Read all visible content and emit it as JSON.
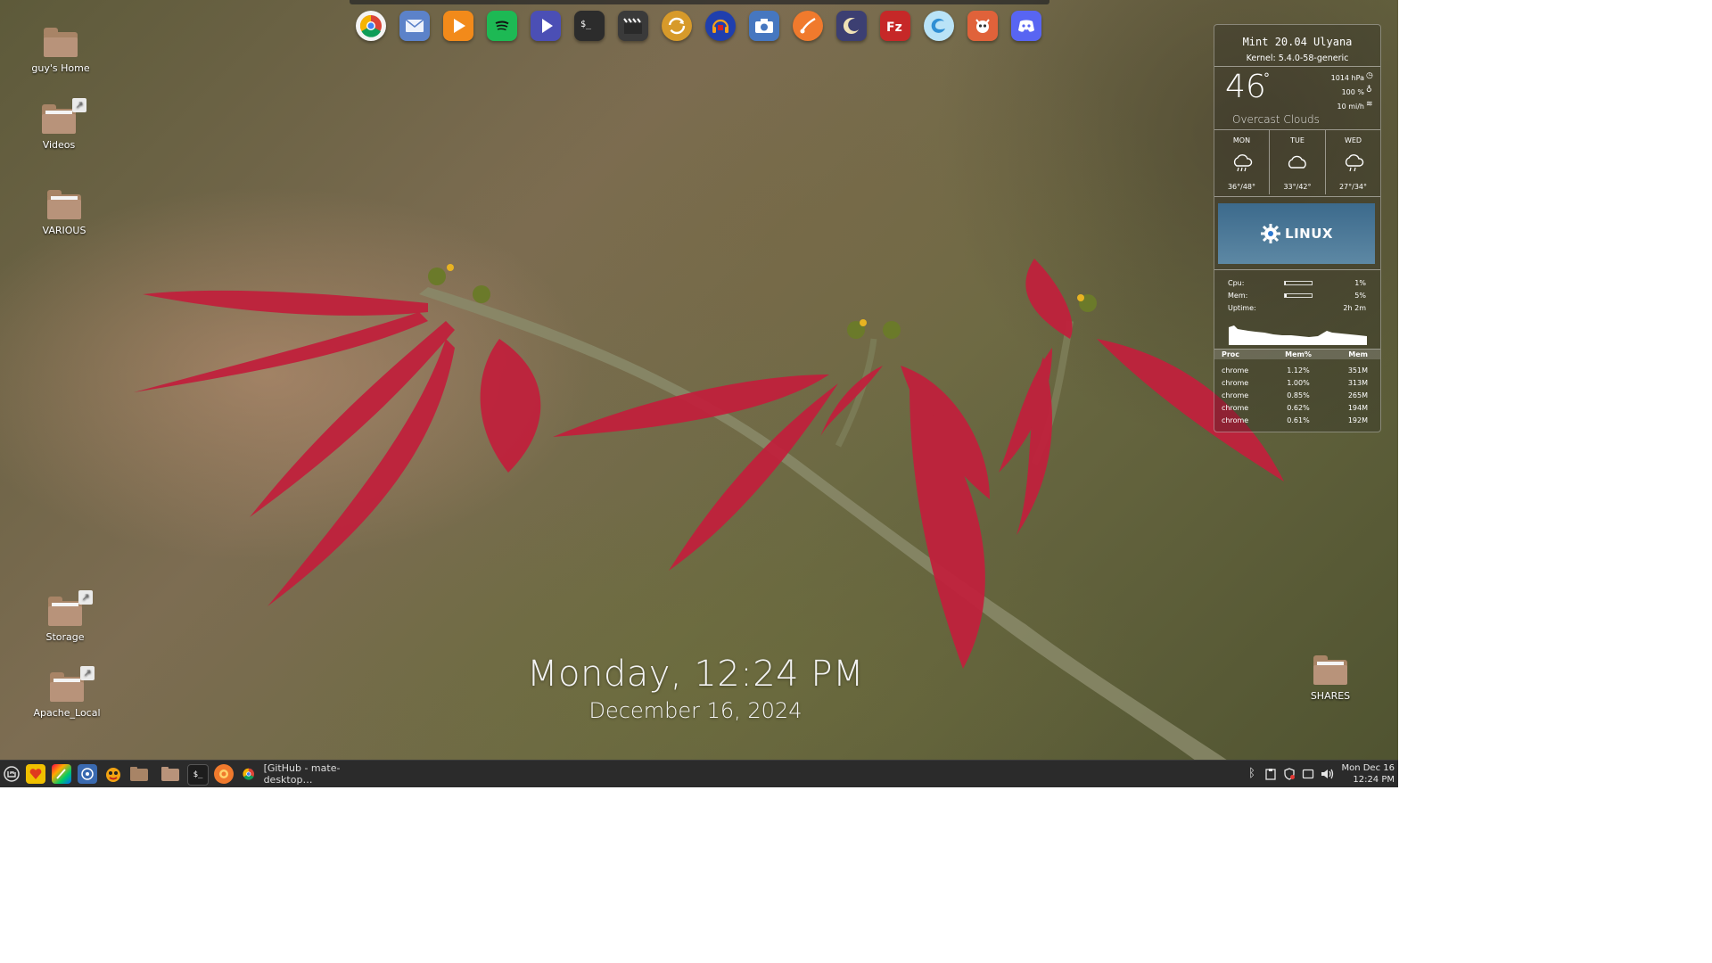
{
  "desktop": {
    "icons": [
      {
        "label": "guy's Home"
      },
      {
        "label": "Videos"
      },
      {
        "label": "VARIOUS"
      },
      {
        "label": "Storage"
      },
      {
        "label": "Apache_Local"
      },
      {
        "label": "SHARES"
      }
    ],
    "clock": {
      "time": "Monday, 12:24 PM",
      "date": "December 16, 2024"
    }
  },
  "dock": {
    "apps": [
      {
        "name": "Chrome",
        "icon": "chrome-icon",
        "color": "#ffffff"
      },
      {
        "name": "Mail",
        "icon": "mail-icon",
        "color": "#5c82c9"
      },
      {
        "name": "Media Player",
        "icon": "play-icon",
        "color": "#f28a1a"
      },
      {
        "name": "Spotify",
        "icon": "spotify-icon",
        "color": "#1db954"
      },
      {
        "name": "Video Player",
        "icon": "video-play-icon",
        "color": "#4b4fb5"
      },
      {
        "name": "Terminal",
        "icon": "terminal-icon",
        "color": "#2c2c2c"
      },
      {
        "name": "Video Editor",
        "icon": "clapper-icon",
        "color": "#3a3a3a"
      },
      {
        "name": "Sync",
        "icon": "sync-icon",
        "color": "#d79a2a"
      },
      {
        "name": "Audacity",
        "icon": "audio-headphones-icon",
        "color": "#1f3fae"
      },
      {
        "name": "Screenshot",
        "icon": "camera-icon",
        "color": "#4677c0"
      },
      {
        "name": "Media Player 2",
        "icon": "note-icon",
        "color": "#f07a2d"
      },
      {
        "name": "Night Theme",
        "icon": "moon-icon",
        "color": "#3c3f72"
      },
      {
        "name": "FileZilla",
        "icon": "filezilla-icon",
        "color": "#c62828"
      },
      {
        "name": "Edge",
        "icon": "edge-icon",
        "color": "#6bc4f0"
      },
      {
        "name": "GIMP",
        "icon": "gimp-icon",
        "color": "#e0623a"
      },
      {
        "name": "Discord",
        "icon": "discord-icon",
        "color": "#5865f2"
      }
    ]
  },
  "conky": {
    "os_name": "Mint 20.04 Ulyana",
    "kernel": "Kernel: 5.4.0-58-generic",
    "weather": {
      "temp": "46",
      "degree": "°",
      "condition": "Overcast Clouds",
      "pressure": "1014 hPa",
      "humidity": "100 %",
      "wind": "10 mi/h",
      "forecast": [
        {
          "day": "MON",
          "range": "36°/48°",
          "icon": "cloud-rain-icon"
        },
        {
          "day": "TUE",
          "range": "33°/42°",
          "icon": "cloud-icon"
        },
        {
          "day": "WED",
          "range": "27°/34°",
          "icon": "cloud-rain-icon"
        }
      ]
    },
    "banner": {
      "text": "LINUX",
      "subtext": "LINUX"
    },
    "system": {
      "cpu_label": "Cpu:",
      "cpu_value": "1%",
      "cpu_fraction": 0.01,
      "mem_label": "Mem:",
      "mem_value": "5%",
      "mem_fraction": 0.05,
      "uptime_label": "Uptime:",
      "uptime_value": "2h 2m"
    },
    "procs": {
      "headers": [
        "Proc",
        "Mem%",
        "Mem"
      ],
      "rows": [
        [
          "chrome",
          "1.12%",
          "351M"
        ],
        [
          "chrome",
          "1.00%",
          "313M"
        ],
        [
          "chrome",
          "0.85%",
          "265M"
        ],
        [
          "chrome",
          "0.62%",
          "194M"
        ],
        [
          "chrome",
          "0.61%",
          "192M"
        ]
      ]
    }
  },
  "taskbar": {
    "window_title": "[GitHub - mate-desktop…",
    "clock_day": "Mon Dec 16",
    "clock_time": "12:24 PM"
  },
  "colors": {
    "accent": "#2b2b2b",
    "panel": "#2b2b2b"
  }
}
